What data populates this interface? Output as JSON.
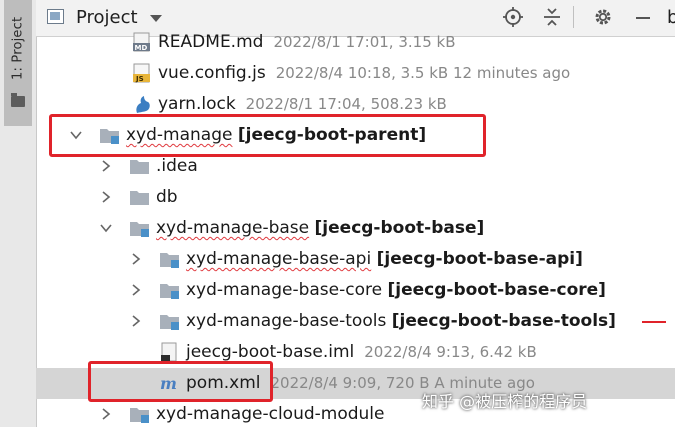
{
  "sidebar": {
    "tab_label": "1: Project"
  },
  "toolbar": {
    "title": "Project",
    "suffix": "b"
  },
  "tree": {
    "rows": [
      {
        "name": "README.md",
        "meta": "2022/8/1 17:01, 3.15 kB"
      },
      {
        "name": "vue.config.js",
        "meta": "2022/8/4 10:18, 3.5 kB 12 minutes ago"
      },
      {
        "name": "yarn.lock",
        "meta": "2022/8/1 17:04, 508.23 kB"
      },
      {
        "name": "xyd-manage",
        "bracket": "[jeecg-boot-parent]"
      },
      {
        "name": ".idea"
      },
      {
        "name": "db"
      },
      {
        "name": "xyd-manage-base",
        "bracket": "[jeecg-boot-base]"
      },
      {
        "name": "xyd-manage-base-api",
        "bracket": "[jeecg-boot-base-api]"
      },
      {
        "name": "xyd-manage-base-core",
        "bracket": "[jeecg-boot-base-core]"
      },
      {
        "name": "xyd-manage-base-tools",
        "bracket": "[jeecg-boot-base-tools]"
      },
      {
        "name": "jeecg-boot-base.iml",
        "meta": "2022/8/4 9:13, 6.42 kB"
      },
      {
        "name": "pom.xml",
        "meta": "2022/8/4 9:09, 720 B A minute ago"
      },
      {
        "name": "xyd-manage-cloud-module"
      }
    ]
  },
  "watermark": "知乎 @被压榨的程序员",
  "colors": {
    "highlight_box": "#e0232a",
    "selected_row": "#d5d5d5",
    "folder_blue": "#4a90c8"
  }
}
